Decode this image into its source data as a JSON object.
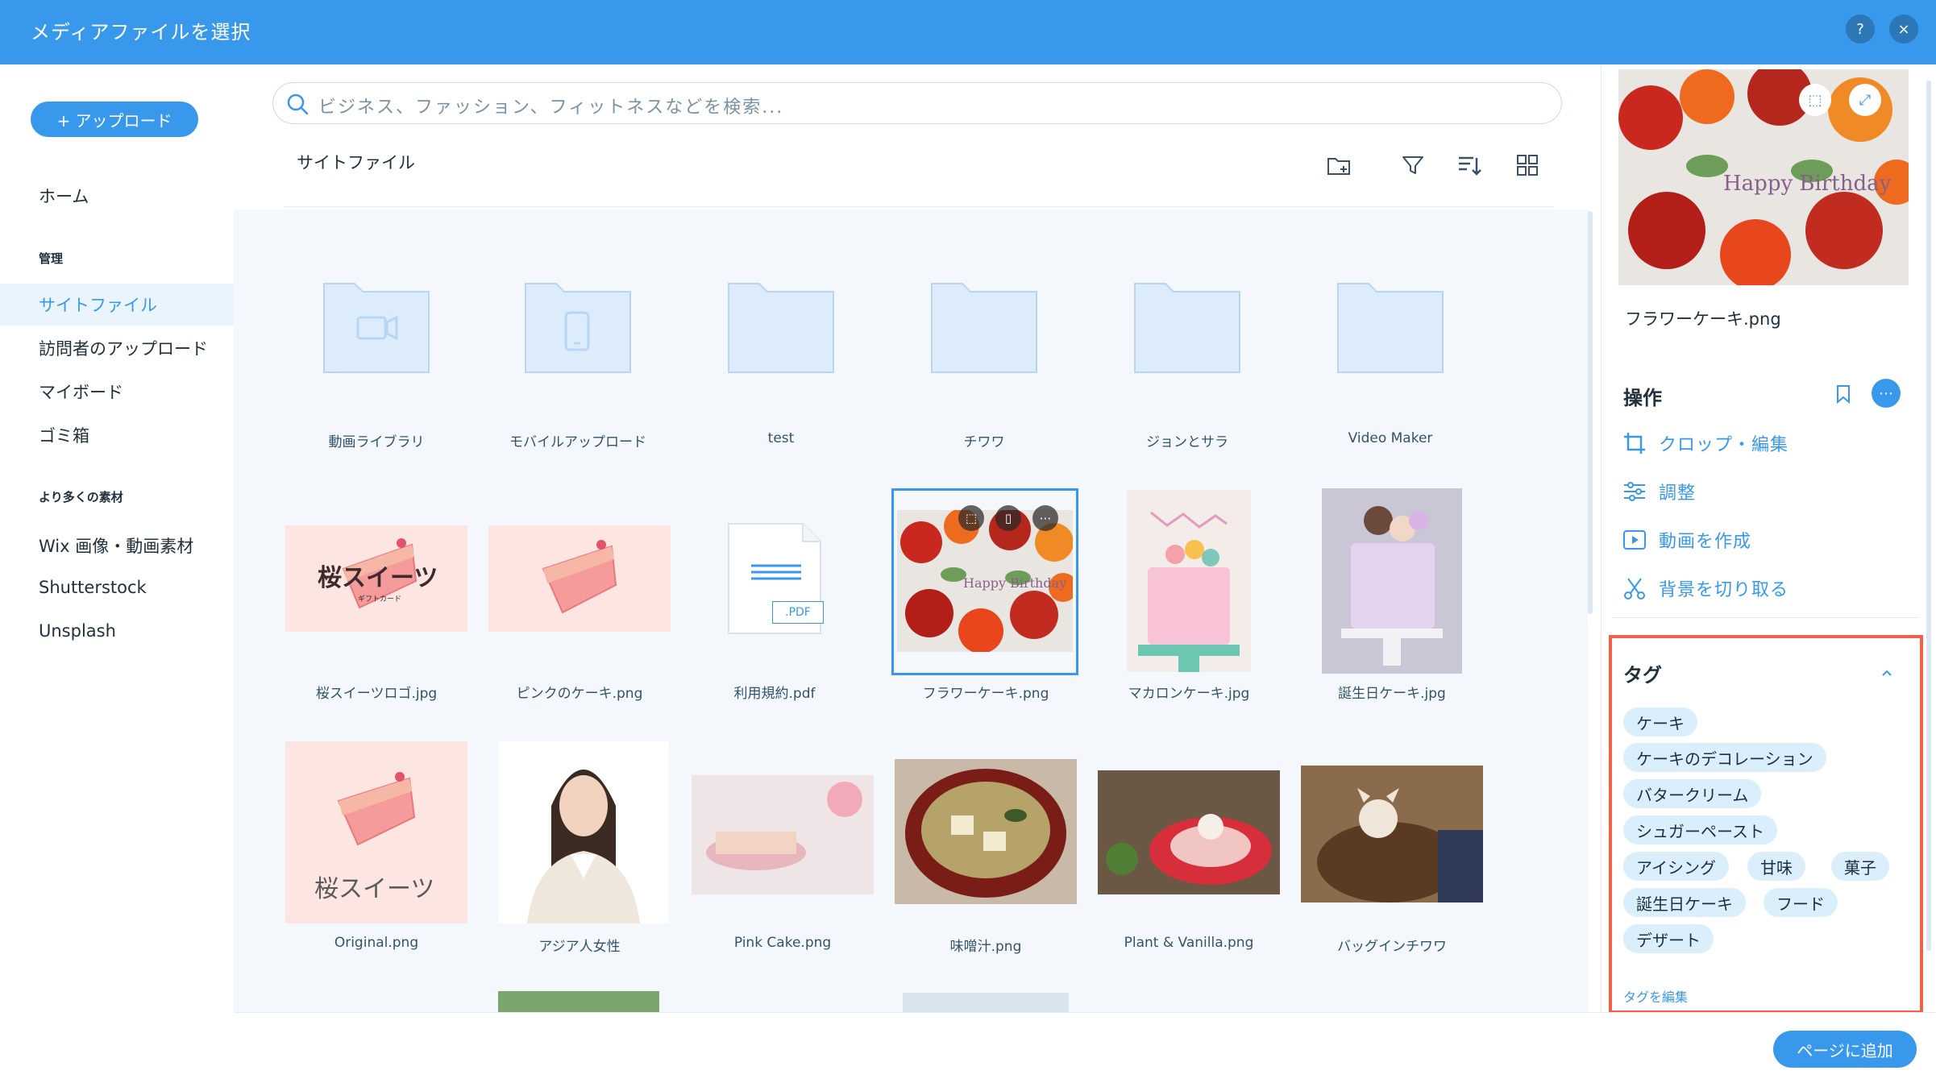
{
  "header": {
    "title": "メディアファイルを選択",
    "help_label": "?",
    "close_label": "×"
  },
  "sidebar": {
    "upload_label": "+ アップロード",
    "home": "ホーム",
    "section_manage": "管理",
    "items_manage": [
      "サイトファイル",
      "訪問者のアップロード",
      "マイボード",
      "ゴミ箱"
    ],
    "section_more": "より多くの素材",
    "items_more": [
      "Wix 画像・動画素材",
      "Shutterstock",
      "Unsplash"
    ]
  },
  "search": {
    "placeholder": "ビジネス、ファッション、フィットネスなどを検索..."
  },
  "breadcrumb": "サイトファイル",
  "folders": [
    "動画ライブラリ",
    "モバイルアップロード",
    "test",
    "チワワ",
    "ジョンとサラ",
    "Video Maker"
  ],
  "files_row1": [
    "桜スイーツロゴ.jpg",
    "ピンクのケーキ.png",
    "利用規約.pdf",
    "フラワーケーキ.png",
    "マカロンケーキ.jpg",
    "誕生日ケーキ.jpg"
  ],
  "files_row2": [
    "Original.png",
    "アジア人女性",
    "Pink Cake.png",
    "味噌汁.png",
    "Plant & Vanilla.png",
    "バッグインチワワ"
  ],
  "thumb_text": {
    "logo1": "桜スイーツ",
    "logo1_sub": "ギフトカード",
    "logo2": "桜スイーツ",
    "pdf_badge": ".PDF",
    "cake_script": "Happy Birthday"
  },
  "right_panel": {
    "file_name": "フラワーケーキ.png",
    "actions_title": "操作",
    "actions": [
      "クロップ・編集",
      "調整",
      "動画を作成",
      "背景を切り取る"
    ],
    "tags_title": "タグ",
    "tags": [
      "ケーキ",
      "ケーキのデコレーション",
      "バタークリーム",
      "シュガーペースト",
      "アイシング",
      "甘味",
      "菓子",
      "誕生日ケーキ",
      "フード",
      "デザート"
    ],
    "edit_tags": "タグを編集"
  },
  "footer": {
    "add_to_page": "ページに追加"
  },
  "colors": {
    "accent": "#3899ec",
    "highlight_border": "#f0634a",
    "tag_bg": "#daeefc"
  }
}
